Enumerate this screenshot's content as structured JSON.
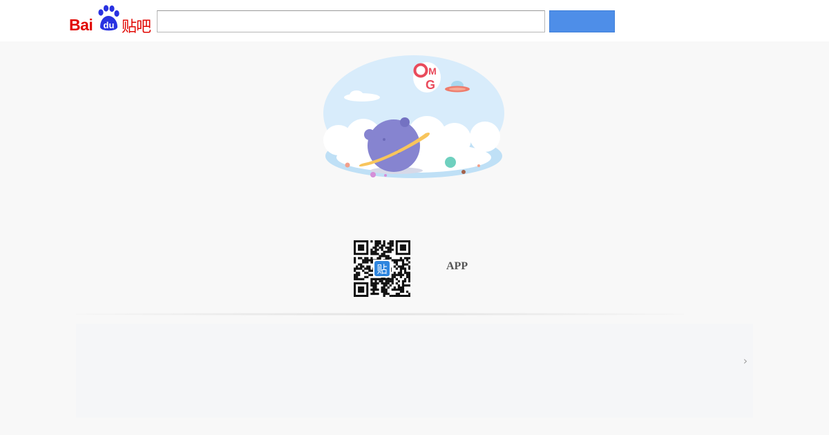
{
  "header": {
    "logo_text_bai": "Bai",
    "logo_text_du": "du",
    "logo_text_tieba": "贴吧",
    "search": {
      "value": "",
      "placeholder": ""
    },
    "search_button_label": ""
  },
  "illustration": {
    "sign_text_line1": "OM",
    "sign_text_line2": "G"
  },
  "app_promo": {
    "qr_center_glyph": "贴",
    "label": "APP"
  },
  "carousel": {
    "next_icon": "chevron-right-icon",
    "next_glyph": "›"
  },
  "colors": {
    "brand_red": "#e10601",
    "brand_blue": "#2932e1",
    "button_blue": "#4e8ee8",
    "page_bg": "#f8f8f8",
    "panel_bg": "#f5f6f8"
  }
}
